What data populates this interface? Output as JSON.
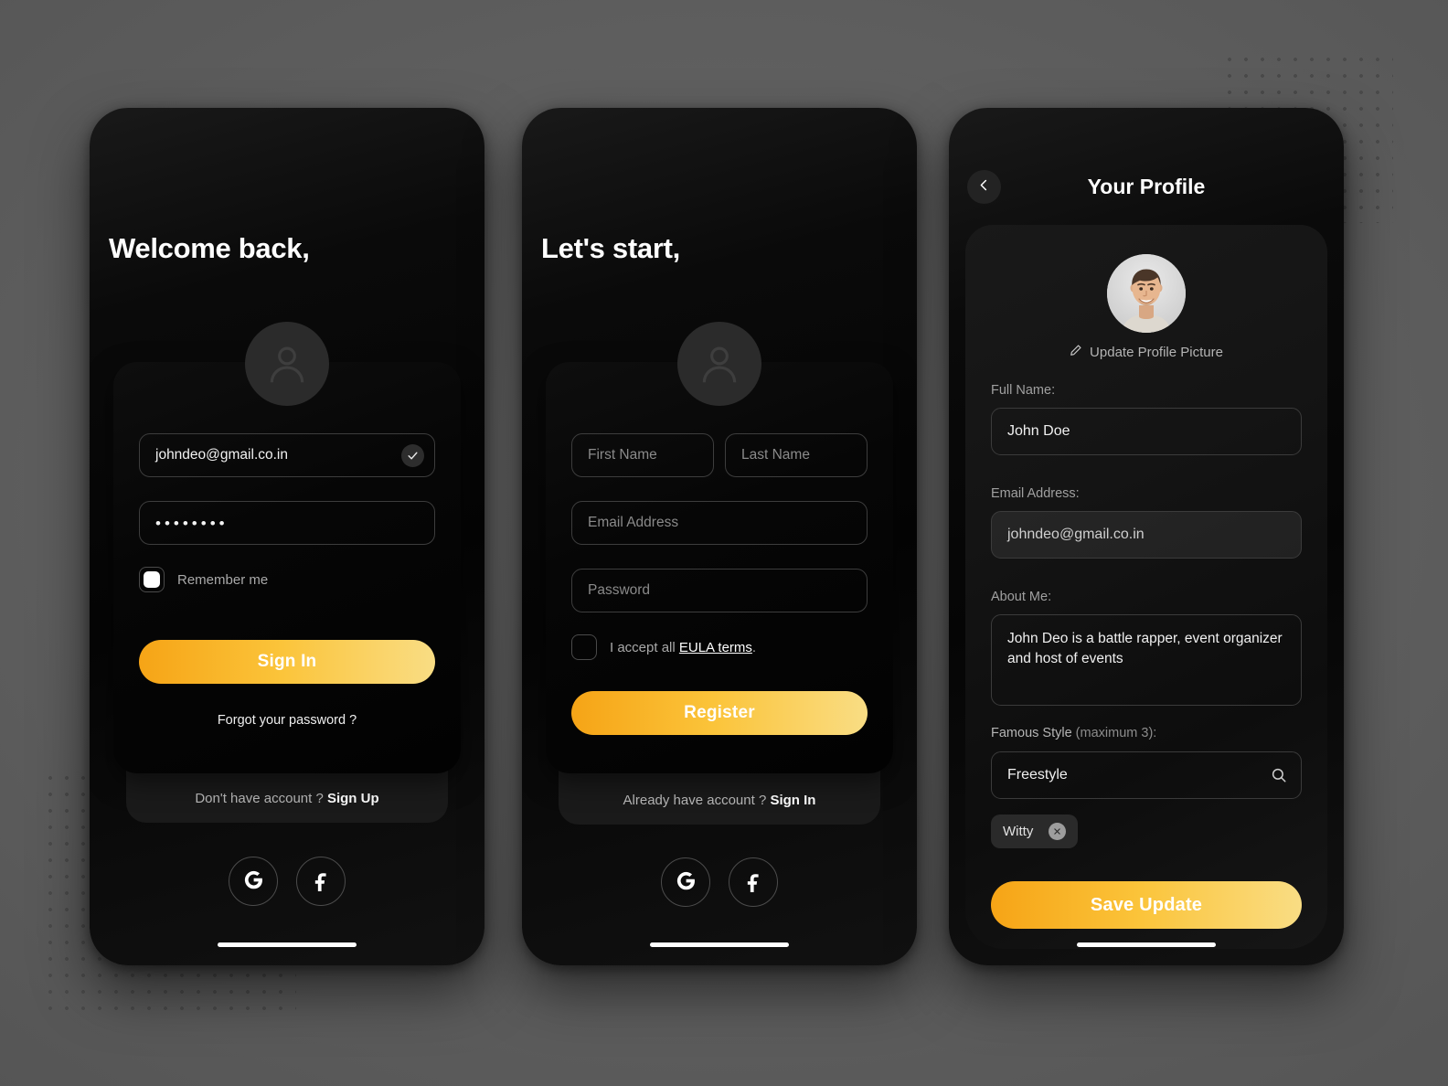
{
  "theme": {
    "accent_start": "#f6a416",
    "accent_end": "#f9dd84",
    "background": "#5f5f5f",
    "surface": "#0a0a0a"
  },
  "signin": {
    "headline": "Welcome back,",
    "email_value": "johndeo@gmail.co.in",
    "email_verified": true,
    "password_value": "••••••••",
    "remember_label": "Remember me",
    "remember_checked": true,
    "submit_label": "Sign In",
    "forgot_label": "Forgot your password ?",
    "switch_prefix": "Don't have account ? ",
    "switch_action": "Sign Up",
    "social": [
      {
        "name": "google-icon",
        "label": "G"
      },
      {
        "name": "facebook-icon",
        "label": "f"
      }
    ]
  },
  "signup": {
    "headline": "Let's start,",
    "first_name_placeholder": "First Name",
    "last_name_placeholder": "Last Name",
    "email_placeholder": "Email Address",
    "password_placeholder": "Password",
    "terms_prefix": "I accept all ",
    "terms_link": "EULA terms",
    "terms_suffix": ".",
    "terms_checked": false,
    "submit_label": "Register",
    "switch_prefix": "Already have account ? ",
    "switch_action": "Sign In",
    "social": [
      {
        "name": "google-icon",
        "label": "G"
      },
      {
        "name": "facebook-icon",
        "label": "f"
      }
    ]
  },
  "profile": {
    "title": "Your Profile",
    "update_picture_label": "Update Profile Picture",
    "full_name_label": "Full Name:",
    "full_name_value": "John Doe",
    "email_label": "Email Address:",
    "email_value": "johndeo@gmail.co.in",
    "about_label": "About Me:",
    "about_value": "John Deo is a battle rapper, event organizer and host of events",
    "style_label": "Famous Style",
    "style_hint": " (maximum 3):",
    "style_value": "Freestyle",
    "tags": [
      {
        "label": "Witty"
      }
    ],
    "submit_label": "Save Update"
  }
}
